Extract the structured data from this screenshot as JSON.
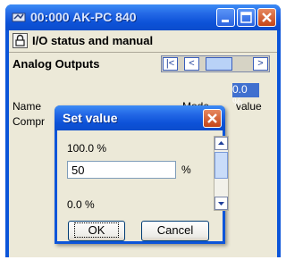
{
  "window": {
    "title": "00:000 AK-PC 840"
  },
  "header": {
    "title": "I/O status and manual"
  },
  "section": {
    "title": "Analog Outputs"
  },
  "nav": {
    "first": "|<",
    "prev": "<",
    "next": ">"
  },
  "table": {
    "columns": [
      "Name",
      "Mode",
      "value"
    ],
    "rows": [
      {
        "name": "Compr",
        "value": "0.0 %"
      }
    ]
  },
  "dialog": {
    "title": "Set value",
    "max": "100.0 %",
    "input_value": "50",
    "unit": "%",
    "min": "0.0 %",
    "ok_label": "OK",
    "cancel_label": "Cancel"
  },
  "colors": {
    "titlebar": "#0c55d9",
    "selection": "#4070cf",
    "close": "#d8552a"
  }
}
